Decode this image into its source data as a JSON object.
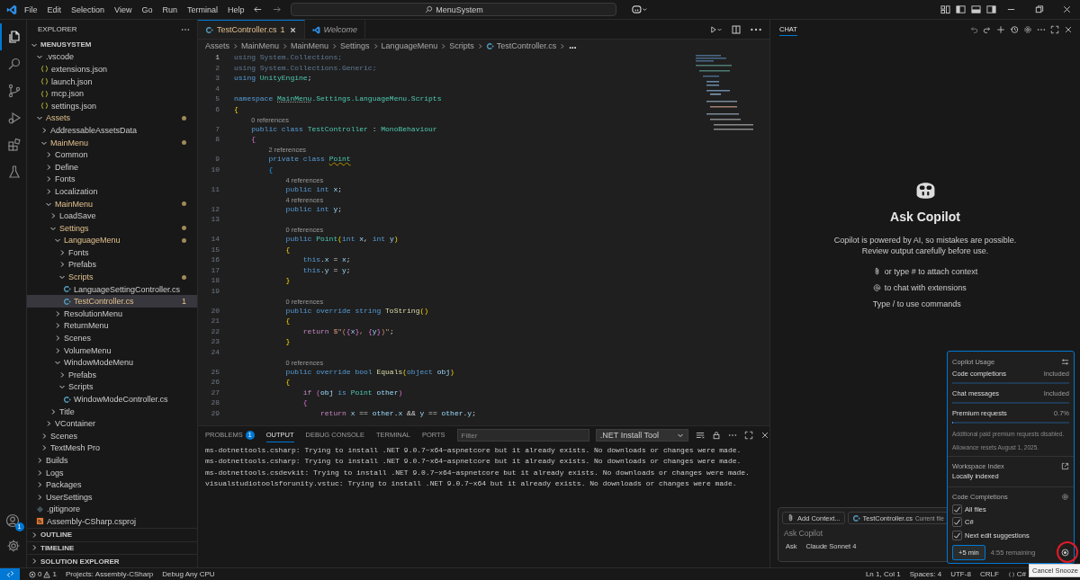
{
  "titlebar": {
    "menus": [
      "File",
      "Edit",
      "Selection",
      "View",
      "Go",
      "Run",
      "Terminal",
      "Help"
    ],
    "search": "MenuSystem"
  },
  "activity": [
    {
      "kind": "explorer",
      "selected": true
    },
    {
      "kind": "search",
      "selected": false
    },
    {
      "kind": "scm",
      "selected": false
    },
    {
      "kind": "debug",
      "selected": false
    },
    {
      "kind": "extensions",
      "selected": false
    },
    {
      "kind": "testing",
      "selected": false
    }
  ],
  "accounts_badge": "1",
  "explorer": {
    "title": "EXPLORER",
    "root": {
      "label": "MENUSYSTEM",
      "expanded": true,
      "children": [
        {
          "label": ".vscode",
          "kind": "folder",
          "expanded": true,
          "modified": false,
          "selected": false,
          "children": [
            {
              "label": "extensions.json",
              "kind": "json",
              "modified": false,
              "selected": false
            },
            {
              "label": "launch.json",
              "kind": "json",
              "modified": false,
              "selected": false
            },
            {
              "label": "mcp.json",
              "kind": "json",
              "modified": false,
              "selected": false
            },
            {
              "label": "settings.json",
              "kind": "json",
              "modified": false,
              "selected": false
            }
          ]
        },
        {
          "label": "Assets",
          "kind": "folder",
          "expanded": true,
          "modified": true,
          "selected": false,
          "children": [
            {
              "label": "AddressableAssetsData",
              "kind": "folder",
              "expanded": false,
              "modified": false,
              "selected": false
            },
            {
              "label": "MainMenu",
              "kind": "folder",
              "expanded": true,
              "modified": true,
              "selected": false,
              "children": [
                {
                  "label": "Common",
                  "kind": "folder",
                  "expanded": false,
                  "modified": false,
                  "selected": false
                },
                {
                  "label": "Define",
                  "kind": "folder",
                  "expanded": false,
                  "modified": false,
                  "selected": false
                },
                {
                  "label": "Fonts",
                  "kind": "folder",
                  "expanded": false,
                  "modified": false,
                  "selected": false
                },
                {
                  "label": "Localization",
                  "kind": "folder",
                  "expanded": false,
                  "modified": false,
                  "selected": false
                },
                {
                  "label": "MainMenu",
                  "kind": "folder",
                  "expanded": true,
                  "modified": true,
                  "selected": false,
                  "children": [
                    {
                      "label": "LoadSave",
                      "kind": "folder",
                      "expanded": false,
                      "modified": false,
                      "selected": false
                    },
                    {
                      "label": "Settings",
                      "kind": "folder",
                      "expanded": true,
                      "modified": true,
                      "selected": false,
                      "children": [
                        {
                          "label": "LanguageMenu",
                          "kind": "folder",
                          "expanded": true,
                          "modified": true,
                          "selected": false,
                          "children": [
                            {
                              "label": "Fonts",
                              "kind": "folder",
                              "expanded": false,
                              "modified": false,
                              "selected": false
                            },
                            {
                              "label": "Prefabs",
                              "kind": "folder",
                              "expanded": false,
                              "modified": false,
                              "selected": false
                            },
                            {
                              "label": "Scripts",
                              "kind": "folder",
                              "expanded": true,
                              "modified": true,
                              "selected": false,
                              "children": [
                                {
                                  "label": "LanguageSettingController.cs",
                                  "kind": "cs",
                                  "modified": false,
                                  "selected": false
                                },
                                {
                                  "label": "TestController.cs",
                                  "kind": "cs",
                                  "modified": true,
                                  "selected": true,
                                  "problems": "1"
                                }
                              ]
                            }
                          ]
                        },
                        {
                          "label": "ResolutionMenu",
                          "kind": "folder",
                          "expanded": false,
                          "modified": false,
                          "selected": false
                        },
                        {
                          "label": "ReturnMenu",
                          "kind": "folder",
                          "expanded": false,
                          "modified": false,
                          "selected": false
                        },
                        {
                          "label": "Scenes",
                          "kind": "folder",
                          "expanded": false,
                          "modified": false,
                          "selected": false
                        },
                        {
                          "label": "VolumeMenu",
                          "kind": "folder",
                          "expanded": false,
                          "modified": false,
                          "selected": false
                        },
                        {
                          "label": "WindowModeMenu",
                          "kind": "folder",
                          "expanded": true,
                          "modified": false,
                          "selected": false,
                          "children": [
                            {
                              "label": "Prefabs",
                              "kind": "folder",
                              "expanded": false,
                              "modified": false,
                              "selected": false
                            },
                            {
                              "label": "Scripts",
                              "kind": "folder",
                              "expanded": true,
                              "modified": false,
                              "selected": false,
                              "children": [
                                {
                                  "label": "WindowModeController.cs",
                                  "kind": "cs",
                                  "modified": false,
                                  "selected": false
                                }
                              ]
                            }
                          ]
                        }
                      ]
                    },
                    {
                      "label": "Title",
                      "kind": "folder",
                      "expanded": false,
                      "modified": false,
                      "selected": false
                    }
                  ]
                },
                {
                  "label": "VContainer",
                  "kind": "folder",
                  "expanded": false,
                  "modified": false,
                  "selected": false
                }
              ]
            },
            {
              "label": "Scenes",
              "kind": "folder",
              "expanded": false,
              "modified": false,
              "selected": false
            },
            {
              "label": "TextMesh Pro",
              "kind": "folder",
              "expanded": false,
              "modified": false,
              "selected": false
            }
          ]
        },
        {
          "label": "Builds",
          "kind": "folder",
          "expanded": false,
          "modified": false,
          "selected": false
        },
        {
          "label": "Logs",
          "kind": "folder",
          "expanded": false,
          "modified": false,
          "selected": false
        },
        {
          "label": "Packages",
          "kind": "folder",
          "expanded": false,
          "modified": false,
          "selected": false
        },
        {
          "label": "UserSettings",
          "kind": "folder",
          "expanded": false,
          "modified": false,
          "selected": false
        },
        {
          "label": ".gitignore",
          "kind": "git",
          "modified": false,
          "selected": false
        },
        {
          "label": "Assembly-CSharp.csproj",
          "kind": "csproj",
          "modified": false,
          "selected": false
        }
      ]
    },
    "sections": [
      {
        "label": "OUTLINE",
        "expanded": false
      },
      {
        "label": "TIMELINE",
        "expanded": false
      },
      {
        "label": "SOLUTION EXPLORER",
        "expanded": false
      }
    ]
  },
  "editor": {
    "tabs": [
      {
        "label": "TestController.cs",
        "kind": "cs",
        "problems": "1",
        "selected": true,
        "preview": false,
        "modified": true
      },
      {
        "label": "Welcome",
        "kind": "welcome",
        "selected": false,
        "preview": true,
        "modified": false
      }
    ],
    "breadcrumbs": [
      {
        "label": "Assets",
        "kind": "folder"
      },
      {
        "label": "MainMenu",
        "kind": "folder"
      },
      {
        "label": "MainMenu",
        "kind": "folder"
      },
      {
        "label": "Settings",
        "kind": "folder"
      },
      {
        "label": "LanguageMenu",
        "kind": "folder"
      },
      {
        "label": "Scripts",
        "kind": "folder"
      },
      {
        "label": "TestController.cs",
        "kind": "cs"
      },
      {
        "label": "...",
        "kind": "more"
      }
    ],
    "lines": [
      {
        "number": "1",
        "current": true,
        "tokens": [
          {
            "text": "using System.Collections;",
            "kind": "unused"
          }
        ]
      },
      {
        "number": "2",
        "current": false,
        "tokens": [
          {
            "text": "using System.Collections.Generic;",
            "kind": "unused"
          }
        ]
      },
      {
        "number": "3",
        "current": false,
        "tokens": [
          {
            "text": "using ",
            "kind": "kw"
          },
          {
            "text": "UnityEngine",
            "kind": "type"
          },
          {
            "text": ";",
            "kind": "plain"
          }
        ]
      },
      {
        "number": "4",
        "current": false
      },
      {
        "number": "5",
        "current": false,
        "tokens": [
          {
            "text": "namespace ",
            "kind": "kw"
          },
          {
            "text": "MainMenu",
            "kind": "info"
          },
          {
            "text": ".Settings.LanguageMenu.Scripts",
            "kind": "type"
          }
        ]
      },
      {
        "number": "6",
        "current": false,
        "tokens": [
          {
            "text": "{",
            "kind": "b1"
          }
        ]
      },
      {
        "number": "7",
        "current": false,
        "lens": "0 references",
        "tokens": [
          {
            "text": "    public class ",
            "kind": "kw"
          },
          {
            "text": "TestController",
            "kind": "type"
          },
          {
            "text": " : ",
            "kind": "plain"
          },
          {
            "text": "MonoBehaviour",
            "kind": "type"
          }
        ]
      },
      {
        "number": "8",
        "current": false,
        "tokens": [
          {
            "text": "    {",
            "kind": "b2"
          }
        ]
      },
      {
        "number": "9",
        "current": false,
        "lens": "2 references",
        "tokens": [
          {
            "text": "        private class ",
            "kind": "kw"
          },
          {
            "text": "Point",
            "kind": "warn"
          }
        ]
      },
      {
        "number": "10",
        "current": false,
        "tokens": [
          {
            "text": "        {",
            "kind": "b3"
          }
        ]
      },
      {
        "number": "11",
        "current": false,
        "lens": "4 references",
        "tokens": [
          {
            "text": "            public int ",
            "kind": "kw"
          },
          {
            "text": "x",
            "kind": "var"
          },
          {
            "text": ";",
            "kind": "plain"
          }
        ]
      },
      {
        "number": "12",
        "current": false,
        "lens": "4 references",
        "tokens": [
          {
            "text": "            public int ",
            "kind": "kw"
          },
          {
            "text": "y",
            "kind": "var"
          },
          {
            "text": ";",
            "kind": "plain"
          }
        ]
      },
      {
        "number": "13",
        "current": false
      },
      {
        "number": "14",
        "current": false,
        "lens": "0 references",
        "tokens": [
          {
            "text": "            public ",
            "kind": "kw"
          },
          {
            "text": "Point",
            "kind": "type"
          },
          {
            "text": "(",
            "kind": "b1"
          },
          {
            "text": "int ",
            "kind": "kw"
          },
          {
            "text": "x",
            "kind": "var"
          },
          {
            "text": ", ",
            "kind": "plain"
          },
          {
            "text": "int ",
            "kind": "kw"
          },
          {
            "text": "y",
            "kind": "var"
          },
          {
            "text": ")",
            "kind": "b1"
          }
        ]
      },
      {
        "number": "15",
        "current": false,
        "tokens": [
          {
            "text": "            {",
            "kind": "b1"
          }
        ]
      },
      {
        "number": "16",
        "current": false,
        "tokens": [
          {
            "text": "                this",
            "kind": "kw"
          },
          {
            "text": ".",
            "kind": "plain"
          },
          {
            "text": "x",
            "kind": "var"
          },
          {
            "text": " = ",
            "kind": "plain"
          },
          {
            "text": "x",
            "kind": "var"
          },
          {
            "text": ";",
            "kind": "plain"
          }
        ]
      },
      {
        "number": "17",
        "current": false,
        "tokens": [
          {
            "text": "                this",
            "kind": "kw"
          },
          {
            "text": ".",
            "kind": "plain"
          },
          {
            "text": "y",
            "kind": "var"
          },
          {
            "text": " = ",
            "kind": "plain"
          },
          {
            "text": "y",
            "kind": "var"
          },
          {
            "text": ";",
            "kind": "plain"
          }
        ]
      },
      {
        "number": "18",
        "current": false,
        "tokens": [
          {
            "text": "            }",
            "kind": "b1"
          }
        ]
      },
      {
        "number": "19",
        "current": false
      },
      {
        "number": "20",
        "current": false,
        "lens": "0 references",
        "tokens": [
          {
            "text": "            public override string ",
            "kind": "kw"
          },
          {
            "text": "ToString",
            "kind": "fn"
          },
          {
            "text": "()",
            "kind": "b1"
          }
        ]
      },
      {
        "number": "21",
        "current": false,
        "tokens": [
          {
            "text": "            {",
            "kind": "b1"
          }
        ]
      },
      {
        "number": "22",
        "current": false,
        "tokens": [
          {
            "text": "                return ",
            "kind": "ctrl"
          },
          {
            "text": "$\"(",
            "kind": "str"
          },
          {
            "text": "{",
            "kind": "b2"
          },
          {
            "text": "x",
            "kind": "var"
          },
          {
            "text": "}",
            "kind": "b2"
          },
          {
            "text": ", ",
            "kind": "str"
          },
          {
            "text": "{",
            "kind": "b2"
          },
          {
            "text": "y",
            "kind": "var"
          },
          {
            "text": "}",
            "kind": "b2"
          },
          {
            "text": ")\"",
            "kind": "str"
          },
          {
            "text": ";",
            "kind": "plain"
          }
        ]
      },
      {
        "number": "23",
        "current": false,
        "tokens": [
          {
            "text": "            }",
            "kind": "b1"
          }
        ]
      },
      {
        "number": "24",
        "current": false
      },
      {
        "number": "25",
        "current": false,
        "lens": "0 references",
        "tokens": [
          {
            "text": "            public override bool ",
            "kind": "kw"
          },
          {
            "text": "Equals",
            "kind": "fn"
          },
          {
            "text": "(",
            "kind": "b1"
          },
          {
            "text": "object ",
            "kind": "kw"
          },
          {
            "text": "obj",
            "kind": "var"
          },
          {
            "text": ")",
            "kind": "b1"
          }
        ]
      },
      {
        "number": "26",
        "current": false,
        "tokens": [
          {
            "text": "            {",
            "kind": "b1"
          }
        ]
      },
      {
        "number": "27",
        "current": false,
        "tokens": [
          {
            "text": "                if ",
            "kind": "ctrl"
          },
          {
            "text": "(",
            "kind": "b2"
          },
          {
            "text": "obj ",
            "kind": "var"
          },
          {
            "text": "is ",
            "kind": "kw"
          },
          {
            "text": "Point ",
            "kind": "type"
          },
          {
            "text": "other",
            "kind": "var"
          },
          {
            "text": ")",
            "kind": "b2"
          }
        ]
      },
      {
        "number": "28",
        "current": false,
        "tokens": [
          {
            "text": "                {",
            "kind": "b2"
          }
        ]
      },
      {
        "number": "29",
        "current": false,
        "tokens": [
          {
            "text": "                    return ",
            "kind": "ctrl"
          },
          {
            "text": "x ",
            "kind": "var"
          },
          {
            "text": "== ",
            "kind": "plain"
          },
          {
            "text": "other",
            "kind": "var"
          },
          {
            "text": ".",
            "kind": "plain"
          },
          {
            "text": "x ",
            "kind": "var"
          },
          {
            "text": "&& ",
            "kind": "plain"
          },
          {
            "text": "y ",
            "kind": "var"
          },
          {
            "text": "== ",
            "kind": "plain"
          },
          {
            "text": "other",
            "kind": "var"
          },
          {
            "text": ".",
            "kind": "plain"
          },
          {
            "text": "y",
            "kind": "var"
          },
          {
            "text": ";",
            "kind": "plain"
          }
        ]
      }
    ]
  },
  "panel": {
    "tabs": [
      {
        "label": "PROBLEMS",
        "badge": "1",
        "selected": false
      },
      {
        "label": "OUTPUT",
        "selected": true
      },
      {
        "label": "DEBUG CONSOLE",
        "selected": false
      },
      {
        "label": "TERMINAL",
        "selected": false
      },
      {
        "label": "PORTS",
        "selected": false
      }
    ],
    "filter_placeholder": "Filter",
    "channel": ".NET Install Tool",
    "lines": [
      "ms-dotnettools.csharp: Trying to install .NET 9.0.7~x64~aspnetcore but it already exists. No downloads or changes were made.",
      "ms-dotnettools.csharp: Trying to install .NET 9.0.7~x64~aspnetcore but it already exists. No downloads or changes were made.",
      "ms-dotnettools.csdevkit: Trying to install .NET 9.0.7~x64~aspnetcore but it already exists. No downloads or changes were made.",
      "visualstudiotoolsforunity.vstuc: Trying to install .NET 9.0.7~x64 but it already exists. No downloads or changes were made."
    ]
  },
  "chat": {
    "tab": "CHAT",
    "title": "Ask Copilot",
    "description": "Copilot is powered by AI, so mistakes are possible. Review output carefully before use.",
    "hints": [
      {
        "kind": "attach",
        "text": "or type # to attach context"
      },
      {
        "kind": "mention",
        "text": "to chat with extensions"
      },
      {
        "kind": "plain",
        "text": "Type / to use commands"
      }
    ],
    "input": {
      "add_context": "Add Context...",
      "file": "TestController.cs",
      "file_note": "Current file",
      "placeholder": "Ask Copilot",
      "mode": "Ask",
      "model": "Claude Sonnet 4"
    }
  },
  "usage": {
    "title": "Copilot Usage",
    "meters": [
      {
        "label": "Code completions",
        "value": "Included",
        "level": 0
      },
      {
        "label": "Chat messages",
        "value": "Included",
        "level": 0
      },
      {
        "label": "Premium requests",
        "value": "0.7%",
        "level": 0.007
      }
    ],
    "notes": [
      "Additional paid premium requests disabled.",
      "Allowance resets August 1, 2025."
    ],
    "index_title": "Workspace Index",
    "index_status": "Locally indexed",
    "completions_title": "Code Completions",
    "options": [
      {
        "label": "All files",
        "checked": true
      },
      {
        "label": "C#",
        "checked": true
      },
      {
        "label": "Next edit suggestions",
        "checked": true
      }
    ],
    "snooze_button": "+5 min",
    "remaining": "4:55 remaining",
    "tooltip": "Cancel Snooze"
  },
  "status": {
    "errors": "0",
    "warnings": "1",
    "left": [
      "Projects: Assembly-CSharp",
      "Debug Any CPU"
    ],
    "right": [
      "Ln 1, Col 1",
      "Spaces: 4",
      "UTF-8",
      "CRLF"
    ],
    "language": "C#"
  }
}
